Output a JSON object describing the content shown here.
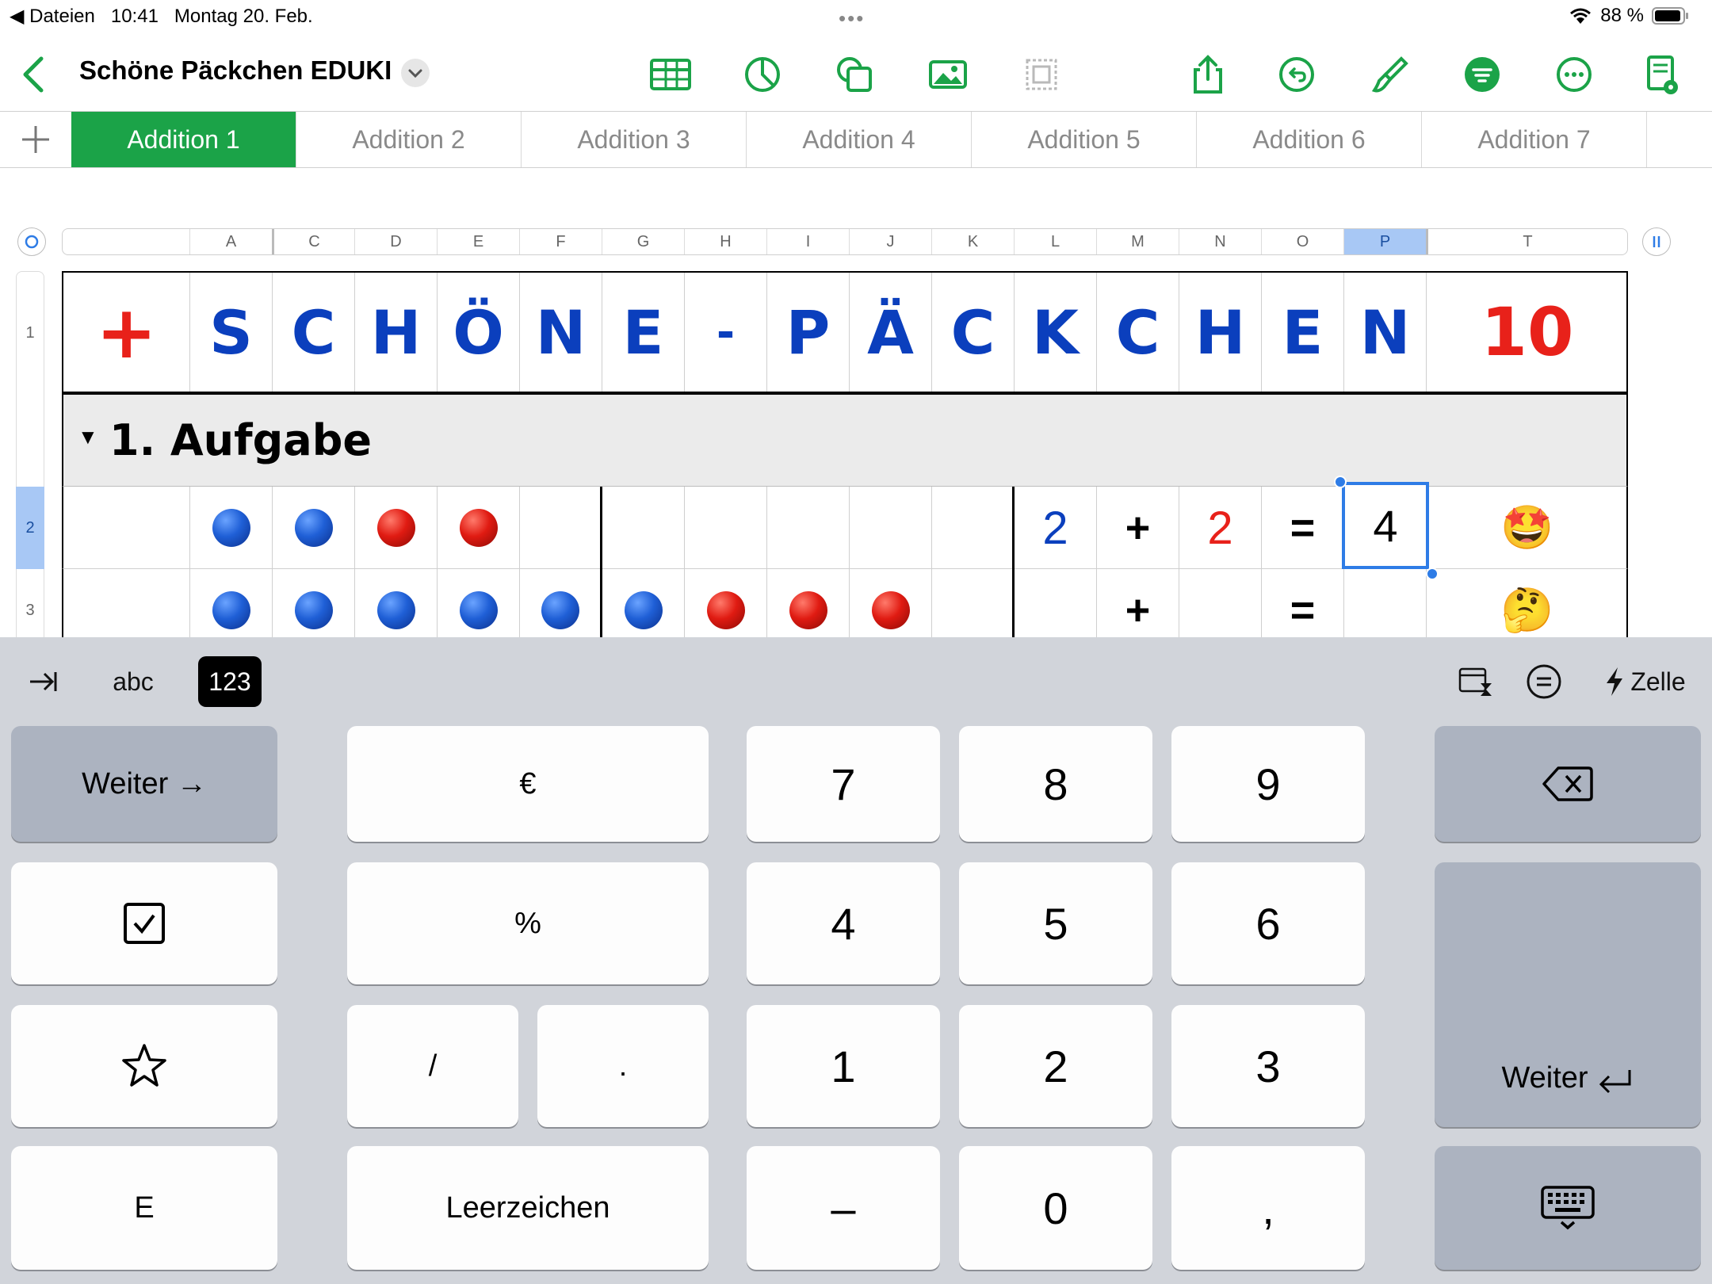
{
  "status": {
    "back_app": "Dateien",
    "time": "10:41",
    "date": "Montag 20. Feb.",
    "battery": "88 %"
  },
  "toolbar": {
    "title": "Schöne Päckchen EDUKI"
  },
  "tabs": [
    "Addition 1",
    "Addition 2",
    "Addition 3",
    "Addition 4",
    "Addition 5",
    "Addition 6",
    "Addition 7"
  ],
  "columns": [
    "A",
    "C",
    "D",
    "E",
    "F",
    "G",
    "H",
    "I",
    "J",
    "K",
    "L",
    "M",
    "N",
    "O",
    "P",
    "T"
  ],
  "rows": [
    "1",
    "2",
    "3"
  ],
  "header_row": {
    "plus": "+",
    "letters": [
      "S",
      "C",
      "H",
      "Ö",
      "N",
      "E",
      "-",
      "P",
      "Ä",
      "C",
      "K",
      "C",
      "H",
      "E",
      "N"
    ],
    "number": "10"
  },
  "group": {
    "label": "1. Aufgabe"
  },
  "row2": {
    "dots": [
      "blue",
      "blue",
      "red",
      "red"
    ],
    "a": "2",
    "op": "+",
    "b": "2",
    "eq": "=",
    "result": "4",
    "emoji": "🤩"
  },
  "row3": {
    "dots": [
      "blue",
      "blue",
      "blue",
      "blue",
      "blue",
      "blue",
      "red",
      "red",
      "red"
    ],
    "op": "+",
    "eq": "=",
    "emoji": "🤔"
  },
  "keyboard": {
    "top": {
      "abc": "abc",
      "num": "123",
      "cell": "Zelle"
    },
    "keys": {
      "next": "Weiter →",
      "euro": "€",
      "percent": "%",
      "slash": "/",
      "dot": ".",
      "space": "Leerzeichen",
      "minus": "–",
      "comma": ",",
      "e": "E",
      "enter": "Weiter",
      "d7": "7",
      "d8": "8",
      "d9": "9",
      "d4": "4",
      "d5": "5",
      "d6": "6",
      "d1": "1",
      "d2": "2",
      "d3": "3",
      "d0": "0"
    }
  },
  "colors": {
    "accent": "#1ba348",
    "selection": "#2e7ce6",
    "letter_blue": "#0b3fbd",
    "red": "#e8211a"
  }
}
